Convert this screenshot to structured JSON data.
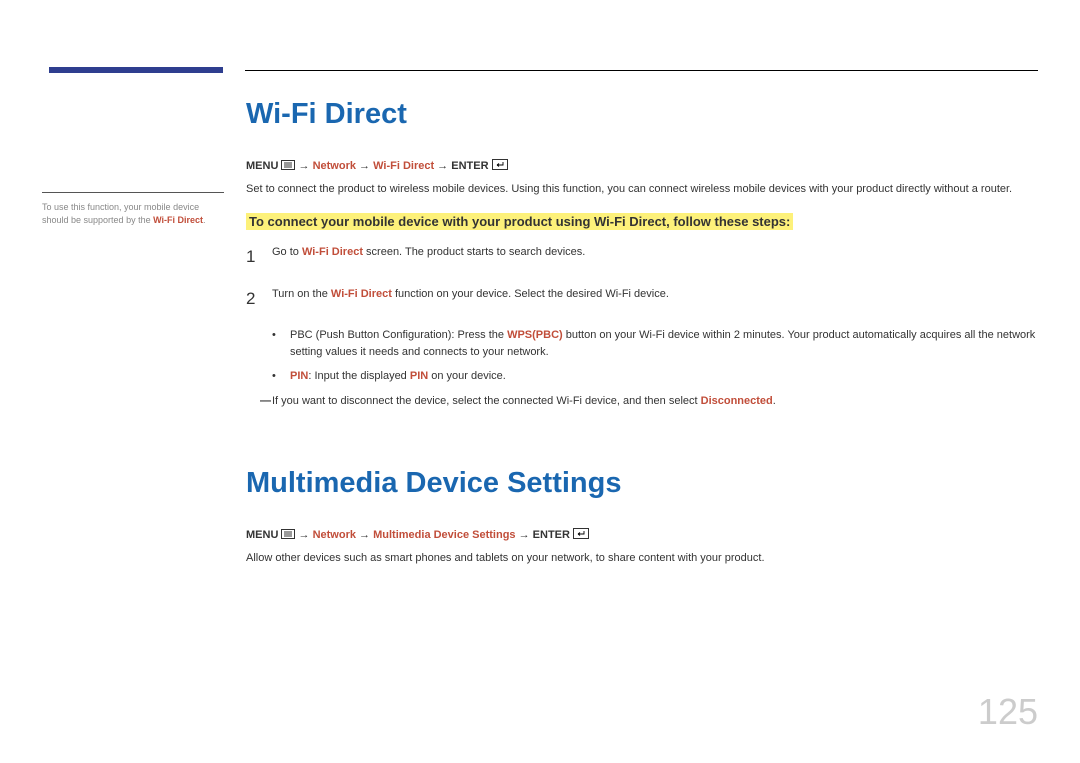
{
  "section1": {
    "title": "Wi-Fi Direct",
    "nav": {
      "menu": "MENU",
      "arrow": " → ",
      "network": "Network",
      "wifi": "Wi-Fi Direct",
      "enter": "ENTER"
    },
    "intro": "Set to connect the product to wireless mobile devices. Using this function, you can connect wireless mobile devices with your product directly without a router.",
    "highlight": "To connect your mobile device with your product using Wi-Fi Direct, follow these steps:",
    "steps": [
      {
        "num": "1",
        "pre": "Go to ",
        "accent": "Wi-Fi Direct",
        "post": " screen. The product starts to search devices."
      },
      {
        "num": "2",
        "pre": "Turn on the ",
        "accent": "Wi-Fi Direct",
        "post": " function on your device. Select the desired Wi-Fi device."
      }
    ],
    "bullets": [
      {
        "pre": "PBC (Push Button Configuration): Press the ",
        "accent": "WPS(PBC)",
        "post": " button on your Wi-Fi device within 2 minutes. Your product automatically acquires all the network setting values it needs and connects to your network."
      },
      {
        "accent1": "PIN",
        "mid": ": Input the displayed ",
        "accent2": "PIN",
        "post": " on your device."
      }
    ],
    "note": {
      "pre": "If you want to disconnect the device, select the connected Wi-Fi device, and then select ",
      "accent": "Disconnected",
      "post": "."
    }
  },
  "section2": {
    "title": "Multimedia Device Settings",
    "nav": {
      "menu": "MENU",
      "arrow": " → ",
      "network": "Network",
      "mds": "Multimedia Device Settings",
      "enter": "ENTER"
    },
    "intro": "Allow other devices such as smart phones and tablets on your network, to share content with your product."
  },
  "sidebar": {
    "pre": "To use this function, your mobile device should be supported by the ",
    "accent": "Wi-Fi Direct",
    "post": "."
  },
  "page_number": "125"
}
